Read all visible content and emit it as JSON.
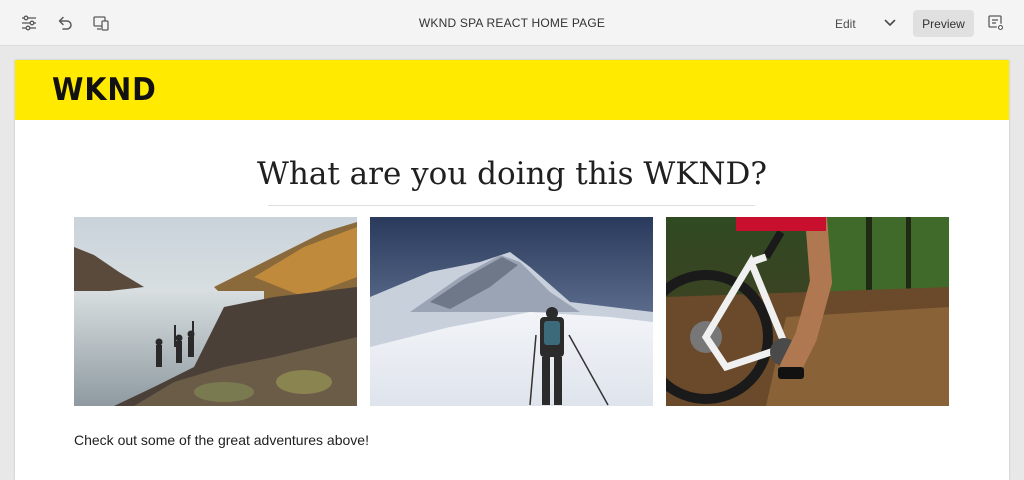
{
  "toolbar": {
    "title": "WKND SPA REACT HOME PAGE",
    "left_icons": [
      "page-properties-icon",
      "undo-icon",
      "emulator-icon"
    ],
    "mode_label": "Edit",
    "preview_label": "Preview",
    "right_icon": "annotations-icon"
  },
  "page": {
    "logo": "WKND",
    "header_color": "#ffea00",
    "headline": "What are you doing this WKND?",
    "images": [
      {
        "subject": "hikers on a rocky lakeshore"
      },
      {
        "subject": "climber walking toward a snowy peak"
      },
      {
        "subject": "mountain bike on a forest trail"
      }
    ],
    "caption": "Check out some of the great adventures above!"
  }
}
